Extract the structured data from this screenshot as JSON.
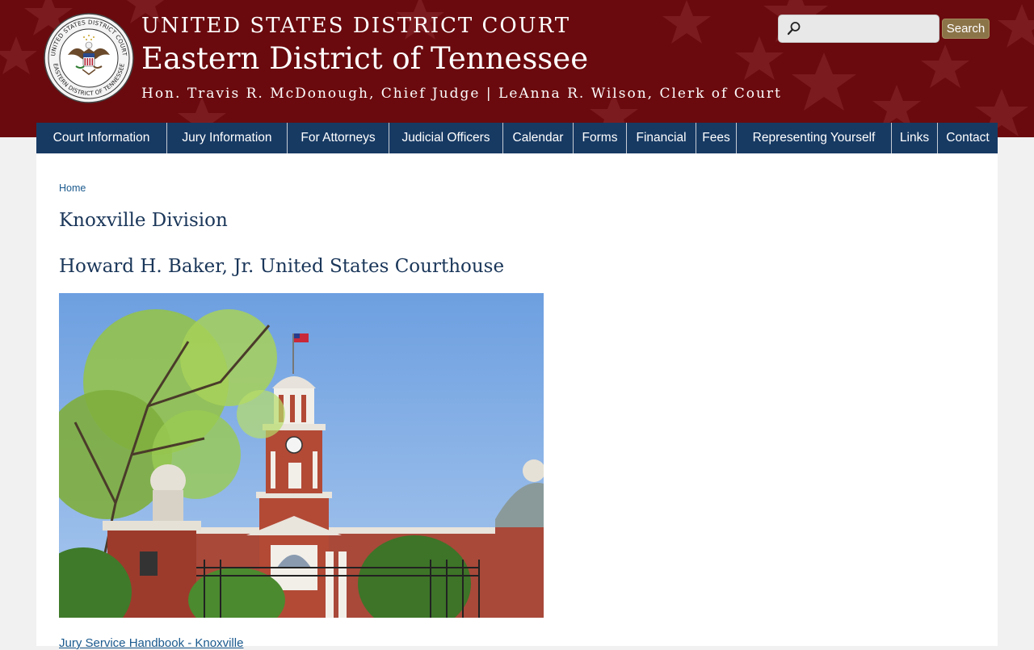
{
  "header": {
    "court": "UNITED STATES DISTRICT COURT",
    "district": "Eastern District of Tennessee",
    "judges": "Hon. Travis R. McDonough, Chief Judge | LeAnna R. Wilson, Clerk of Court",
    "seal_text_top": "UNITED STATES DISTRICT COURT",
    "seal_text_bottom": "EASTERN DISTRICT OF TENNESSEE",
    "seal_icon": "court-seal-eagle",
    "background_color": "#6a0a0e",
    "star_color": "#8a2a2e"
  },
  "search": {
    "placeholder": "",
    "value": "",
    "button_label": "Search",
    "icon": "search-icon",
    "button_color": "#8c7449"
  },
  "nav": {
    "color": "#173a63",
    "items": [
      {
        "label": "Court Information"
      },
      {
        "label": "Jury Information"
      },
      {
        "label": "For Attorneys"
      },
      {
        "label": "Judicial Officers"
      },
      {
        "label": "Calendar"
      },
      {
        "label": "Forms"
      },
      {
        "label": "Financial"
      },
      {
        "label": "Fees"
      },
      {
        "label": "Representing Yourself"
      },
      {
        "label": "Links"
      },
      {
        "label": "Contact"
      }
    ]
  },
  "main": {
    "breadcrumb": "Home",
    "title": "Knoxville Division",
    "section_title": "Howard H. Baker, Jr. United States Courthouse",
    "photo_subject": "courthouse-photo",
    "link": "Jury Service Handbook - Knoxville",
    "link_color": "#1b5a8e",
    "heading_color": "#1a3659"
  }
}
